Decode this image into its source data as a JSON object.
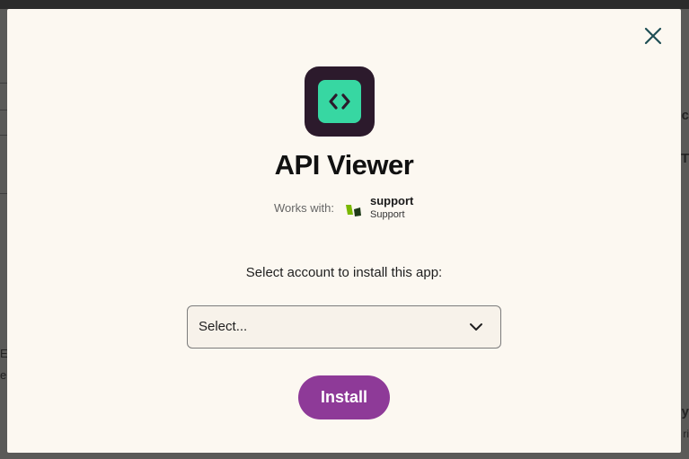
{
  "modal": {
    "app_name": "API Viewer",
    "works_with_label": "Works with:",
    "product": {
      "name": "support",
      "subtitle": "Support"
    },
    "select_prompt": "Select account to install this app:",
    "account_select": {
      "value": "Select..."
    },
    "install_label": "Install"
  },
  "background": {
    "left_fragments": [
      "E",
      "e"
    ],
    "right_fragments": [
      "c",
      "T",
      "y",
      "ri"
    ]
  },
  "colors": {
    "modal_bg": "#fcf8f1",
    "app_icon_bg": "#2c1a2c",
    "app_icon_accent": "#37d7a2",
    "install_button": "#8e3a98",
    "product_logo_green": "#7ab800",
    "product_logo_dark": "#1f3b1a"
  },
  "icons": {
    "close": "close-icon",
    "app": "code-brackets-icon",
    "product": "support-logo-icon",
    "dropdown": "chevron-down-icon"
  }
}
